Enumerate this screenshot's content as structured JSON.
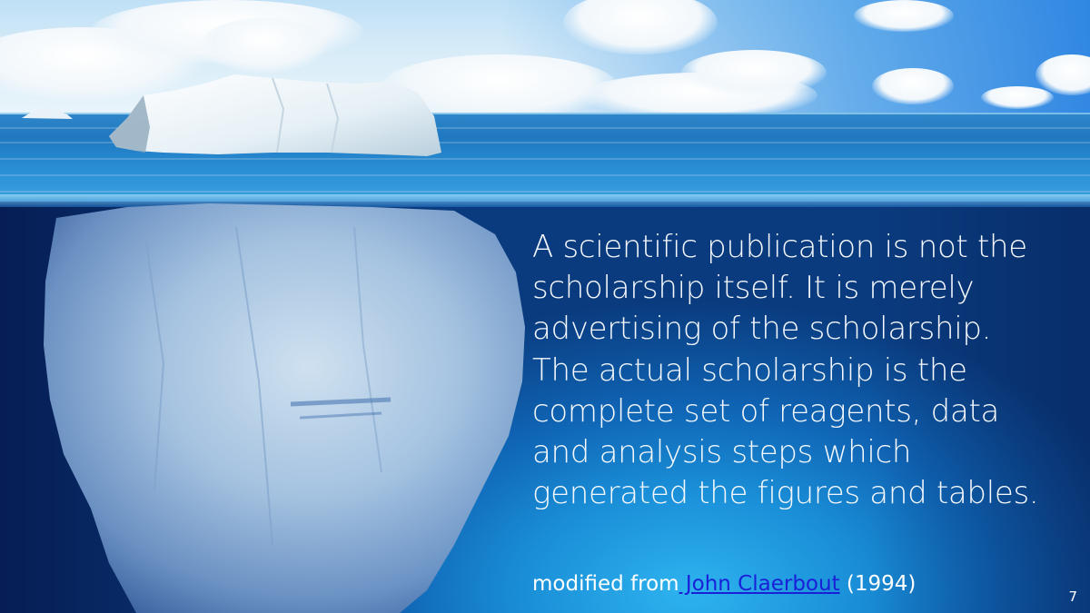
{
  "slide": {
    "quote_lines": [
      "A scientific publication is not the",
      "scholarship itself. It is merely",
      "advertising of the scholarship.",
      "The actual scholarship is the",
      "complete set of reagents, data",
      "and analysis steps which",
      "generated the figures and tables."
    ],
    "attribution": {
      "prefix": "modified from",
      "link_text": " John Claerbout",
      "suffix": " (1994)"
    },
    "page_number": "7",
    "image": "iceberg-photo"
  },
  "colors": {
    "text": "#f4f8fc",
    "link": "#1a20d8",
    "deep_water": "#0a3b7e",
    "light_water": "#2eb3ef",
    "ice": "#e8f2f8"
  }
}
